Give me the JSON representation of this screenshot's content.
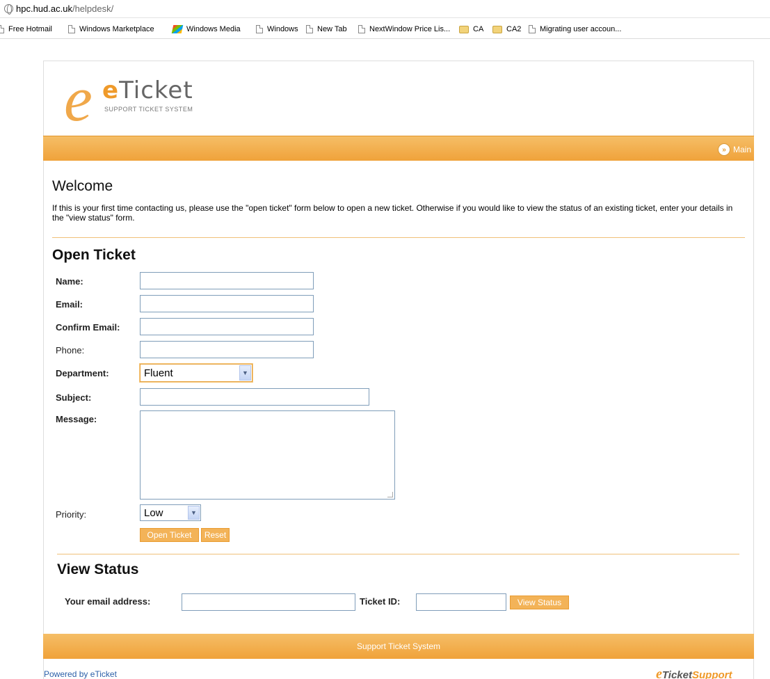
{
  "browser": {
    "url_host": "hpc.hud.ac.uk",
    "url_path": "/helpdesk/",
    "bookmarks": [
      {
        "label": "Free Hotmail",
        "icon": "page-icon"
      },
      {
        "label": "Windows Marketplace",
        "icon": "page-icon"
      },
      {
        "label": "Windows Media",
        "icon": "windows-logo-icon"
      },
      {
        "label": "Windows",
        "icon": "page-icon"
      },
      {
        "label": "New Tab",
        "icon": "page-icon"
      },
      {
        "label": "NextWindow Price Lis...",
        "icon": "page-icon"
      },
      {
        "label": "CA",
        "icon": "folder-icon"
      },
      {
        "label": "CA2",
        "icon": "folder-icon"
      },
      {
        "label": "Migrating user accoun...",
        "icon": "page-icon"
      }
    ]
  },
  "logo": {
    "big_letter": "e",
    "brand_first": "e",
    "brand_rest": "Ticket",
    "tagline": "SUPPORT TICKET SYSTEM"
  },
  "nav": {
    "main_label": "Main",
    "main_icon": "double-chevron-right-icon"
  },
  "welcome": {
    "title": "Welcome",
    "text": "If this is your first time contacting us, please use the \"open ticket\" form below to open a new ticket. Otherwise if you would like to view the status of an existing ticket, enter your details in the \"view status\" form."
  },
  "open_ticket": {
    "title": "Open Ticket",
    "name_label": "Name:",
    "name_value": "",
    "email_label": "Email:",
    "email_value": "",
    "confirm_email_label": "Confirm Email:",
    "confirm_email_value": "",
    "phone_label": "Phone:",
    "phone_value": "",
    "department_label": "Department:",
    "department_value": "Fluent",
    "subject_label": "Subject:",
    "subject_value": "",
    "message_label": "Message:",
    "priority_label": "Priority:",
    "priority_value": "Low",
    "submit_label": "Open Ticket",
    "reset_label": "Reset"
  },
  "view_status": {
    "title": "View Status",
    "email_label": "Your email address:",
    "ticket_label": "Ticket ID:",
    "button_label": "View Status"
  },
  "footer": {
    "bar_text": "Support Ticket System",
    "powered": "Powered by eTicket",
    "logo_e": "e",
    "logo_ticket": "Ticket",
    "logo_support": "Support"
  },
  "colors": {
    "accent_orange": "#f0a23a",
    "link_blue": "#2a5fa8",
    "input_border": "#7f9db9"
  }
}
